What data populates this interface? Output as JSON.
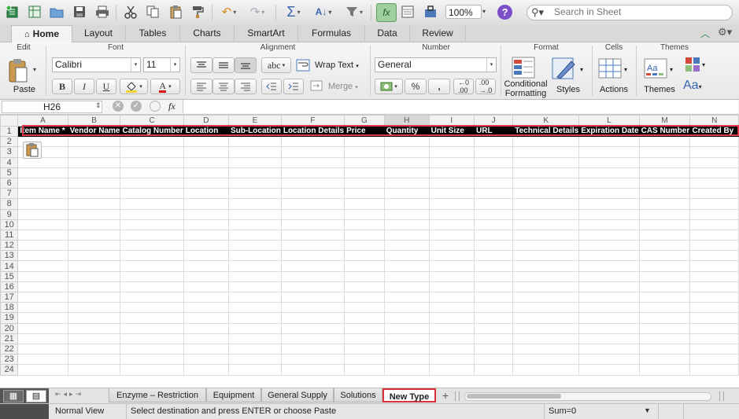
{
  "toolbar": {
    "zoom": "100%",
    "search_placeholder": "Search in Sheet",
    "help": "?"
  },
  "ribbon_tabs": [
    "Home",
    "Layout",
    "Tables",
    "Charts",
    "SmartArt",
    "Formulas",
    "Data",
    "Review"
  ],
  "ribbon": {
    "groups": {
      "edit": "Edit",
      "font": "Font",
      "alignment": "Alignment",
      "number": "Number",
      "format": "Format",
      "cells": "Cells",
      "themes": "Themes"
    },
    "paste": "Paste",
    "font_name": "Calibri",
    "font_size": "11",
    "bold": "B",
    "italic": "I",
    "underline": "U",
    "font_color": "A",
    "abc": "abc",
    "wrap_text": "Wrap Text",
    "merge": "Merge",
    "number_format": "General",
    "percent": "%",
    "comma": ",",
    "conditional_formatting": "Conditional Formatting",
    "styles": "Styles",
    "actions": "Actions",
    "themes": "Themes",
    "aa": "Aa"
  },
  "formula_bar": {
    "name_box": "H26",
    "fx": "fx",
    "value": ""
  },
  "sheet": {
    "columns": [
      "A",
      "B",
      "C",
      "D",
      "E",
      "F",
      "G",
      "H",
      "I",
      "J",
      "K",
      "L",
      "M",
      "N"
    ],
    "selected_column": "H",
    "rows": [
      "1",
      "2",
      "3",
      "4",
      "5",
      "6",
      "7",
      "8",
      "9",
      "10",
      "11",
      "12",
      "13",
      "14",
      "15",
      "16",
      "17",
      "18",
      "19",
      "20",
      "21",
      "22",
      "23",
      "24"
    ],
    "header_row": [
      "Item Name *",
      "Vendor Name",
      "Catalog Number",
      "Location",
      "Sub-Location",
      "Location Details",
      "Price",
      "Quantity",
      "Unit Size",
      "URL",
      "Technical Details",
      "Expiration Date",
      "CAS Number",
      "Created By"
    ]
  },
  "sheet_tabs": [
    "Enzyme – Restriction",
    "Equipment",
    "General Supply",
    "Solutions",
    "New Type"
  ],
  "active_sheet": "New Type",
  "status": {
    "view": "Normal View",
    "message": "Select destination and press ENTER or choose Paste",
    "sum": "Sum=0"
  },
  "colors": {
    "accent_green": "#217346",
    "highlight_red": "#d8323f",
    "header_fill": "#000000"
  }
}
